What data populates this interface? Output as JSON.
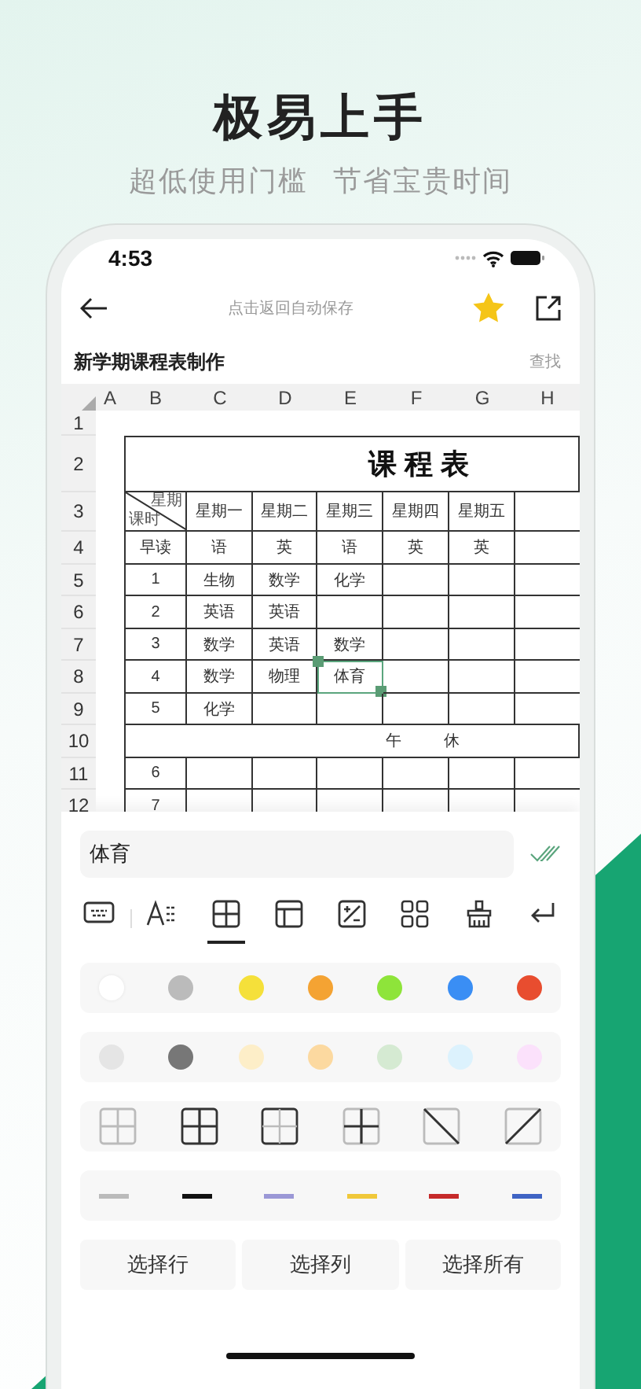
{
  "headline": "极易上手",
  "subtitle": [
    "超低使用门槛",
    "节省宝贵时间"
  ],
  "status_bar": {
    "time": "4:53"
  },
  "toolbar": {
    "hint": "点击返回自动保存",
    "starred": true
  },
  "document": {
    "title": "新学期课程表制作",
    "find": "查找"
  },
  "sheet": {
    "columns": [
      "A",
      "B",
      "C",
      "D",
      "E",
      "F",
      "G",
      "H"
    ],
    "rows": [
      {
        "kind": "blank",
        "label": "1"
      },
      {
        "kind": "title",
        "label": "2",
        "text": "课程表"
      },
      {
        "kind": "header",
        "label": "3",
        "corner_top": "星期",
        "corner_bottom": "课时",
        "days": [
          "星期一",
          "星期二",
          "星期三",
          "星期四",
          "星期五"
        ]
      },
      {
        "kind": "lessons",
        "label": "4",
        "period": "早读",
        "cells": [
          {
            "text": "语",
            "selected": false
          },
          {
            "text": "英",
            "selected": false
          },
          {
            "text": "语",
            "selected": false
          },
          {
            "text": "英",
            "selected": false
          },
          {
            "text": "英",
            "selected": false
          }
        ]
      },
      {
        "kind": "lessons",
        "label": "5",
        "period": "1",
        "cells": [
          {
            "text": "生物",
            "selected": false
          },
          {
            "text": "数学",
            "selected": false
          },
          {
            "text": "化学",
            "selected": false
          },
          {
            "selected": false
          },
          {
            "selected": false
          }
        ]
      },
      {
        "kind": "lessons",
        "label": "6",
        "period": "2",
        "cells": [
          {
            "text": "英语",
            "selected": false
          },
          {
            "text": "英语",
            "selected": false
          },
          {
            "selected": false
          },
          {
            "selected": false
          },
          {
            "selected": false
          }
        ]
      },
      {
        "kind": "lessons",
        "label": "7",
        "period": "3",
        "cells": [
          {
            "text": "数学",
            "selected": false
          },
          {
            "text": "英语",
            "selected": false
          },
          {
            "text": "数学",
            "selected": false
          },
          {
            "selected": false
          },
          {
            "selected": false
          }
        ]
      },
      {
        "kind": "lessons",
        "label": "8",
        "period": "4",
        "cells": [
          {
            "text": "数学",
            "selected": false
          },
          {
            "text": "物理",
            "selected": false
          },
          {
            "text": "体育",
            "selected": true
          },
          {
            "selected": false
          },
          {
            "selected": false
          }
        ]
      },
      {
        "kind": "lessons",
        "label": "9",
        "period": "5",
        "cells": [
          {
            "text": "化学",
            "selected": false
          },
          {
            "selected": false
          },
          {
            "selected": false
          },
          {
            "selected": false
          },
          {
            "selected": false
          }
        ]
      },
      {
        "kind": "break",
        "label": "10",
        "text": "午 休"
      },
      {
        "kind": "lessons",
        "label": "11",
        "period": "6",
        "cells": [
          {
            "selected": false
          },
          {
            "selected": false
          },
          {
            "selected": false
          },
          {
            "selected": false
          },
          {
            "selected": false
          }
        ]
      },
      {
        "kind": "lessons",
        "label": "12",
        "period": "7",
        "cells": [
          {
            "selected": false
          },
          {
            "selected": false
          },
          {
            "selected": false
          },
          {
            "selected": false
          },
          {
            "selected": false
          }
        ]
      }
    ]
  },
  "editor": {
    "value": "体育"
  },
  "tools": [
    {
      "kind": "keyboard",
      "selected": false
    },
    {
      "kind": "text-format",
      "selected": false
    },
    {
      "kind": "borders",
      "selected": true
    },
    {
      "kind": "layout",
      "selected": false
    },
    {
      "kind": "formula",
      "selected": false
    },
    {
      "kind": "apps",
      "selected": false
    },
    {
      "kind": "clear",
      "selected": false
    },
    {
      "kind": "return",
      "selected": false
    }
  ],
  "fill_palettes": [
    {
      "colors": [
        {
          "color": "#ffffff"
        },
        {
          "color": "#bbbbbb"
        },
        {
          "color": "#f5e03a"
        },
        {
          "color": "#f4a333"
        },
        {
          "color": "#8ee43a"
        },
        {
          "color": "#3a8ef4"
        },
        {
          "color": "#e84d2f"
        }
      ]
    },
    {
      "colors": [
        {
          "color": "#e5e5e5"
        },
        {
          "color": "#777777"
        },
        {
          "color": "#fdeec8"
        },
        {
          "color": "#fcd9a0"
        },
        {
          "color": "#d5ead2"
        },
        {
          "color": "#dcf2fd"
        },
        {
          "color": "#fbe1fb"
        }
      ]
    }
  ],
  "border_styles": [
    {
      "kind": "all-light"
    },
    {
      "kind": "all"
    },
    {
      "kind": "outer"
    },
    {
      "kind": "inner"
    },
    {
      "kind": "diagonal-down"
    },
    {
      "kind": "diagonal-up"
    }
  ],
  "line_colors": [
    {
      "color": "#bbbbbb"
    },
    {
      "color": "#111111"
    },
    {
      "color": "#9b98d6"
    },
    {
      "color": "#f0c83a"
    },
    {
      "color": "#c62a2a"
    },
    {
      "color": "#3f64c4"
    }
  ],
  "buttons": [
    "选择行",
    "选择列",
    "选择所有"
  ]
}
